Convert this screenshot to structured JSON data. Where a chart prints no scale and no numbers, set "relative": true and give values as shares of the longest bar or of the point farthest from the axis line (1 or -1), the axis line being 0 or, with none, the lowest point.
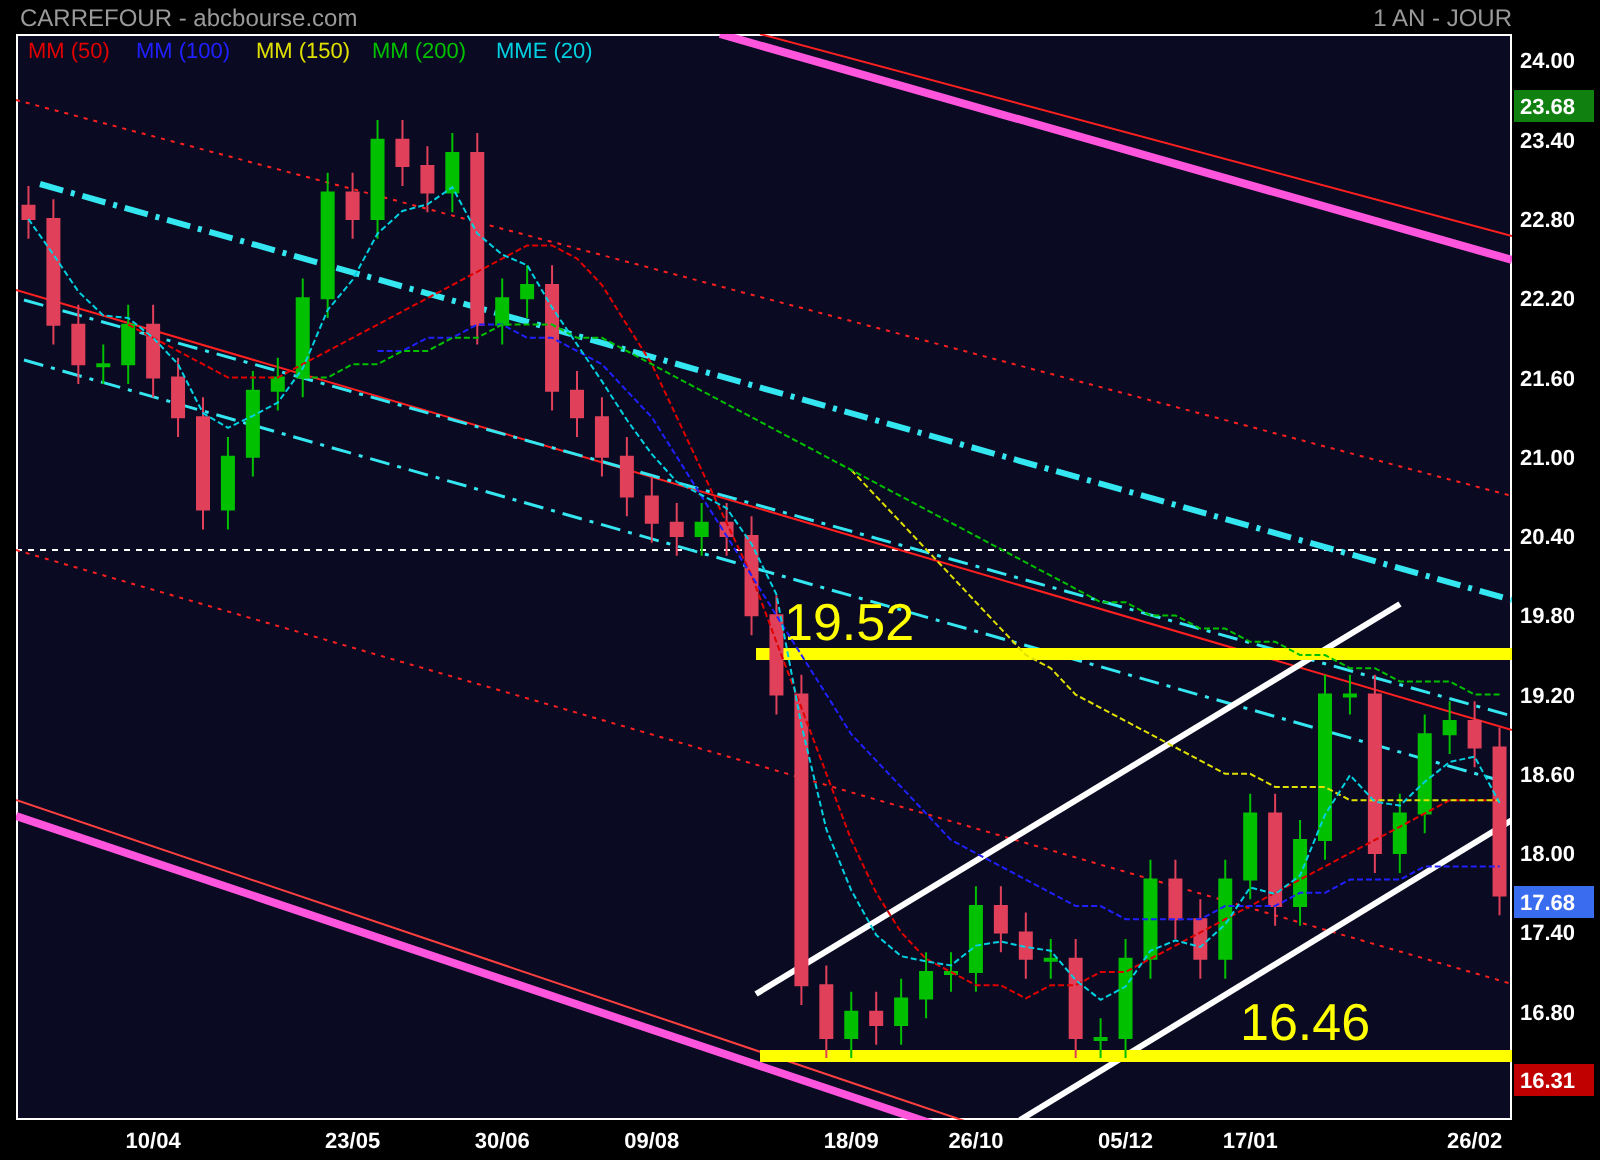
{
  "header": {
    "title": "CARREFOUR - abcbourse.com",
    "period": "1 AN - JOUR"
  },
  "chart": {
    "chart_data": {
      "type": "candlestick",
      "categories": [
        null,
        null,
        null,
        null,
        null,
        "10/04",
        null,
        null,
        null,
        null,
        null,
        null,
        null,
        "23/05",
        null,
        null,
        null,
        null,
        null,
        "30/06",
        null,
        null,
        null,
        null,
        null,
        "09/08",
        null,
        null,
        null,
        null,
        null,
        null,
        null,
        "18/09",
        null,
        null,
        null,
        null,
        "26/10",
        null,
        null,
        null,
        null,
        null,
        "05/12",
        null,
        null,
        null,
        null,
        "17/01",
        null,
        null,
        null,
        null,
        null,
        null,
        null,
        null,
        "26/02",
        null
      ],
      "ohlc": [
        [
          22.9,
          23.05,
          22.65,
          22.8
        ],
        [
          22.8,
          22.95,
          21.85,
          22.0
        ],
        [
          22.0,
          22.15,
          21.55,
          21.7
        ],
        [
          21.7,
          21.85,
          21.55,
          21.7
        ],
        [
          21.7,
          22.15,
          21.55,
          22.0
        ],
        [
          22.0,
          22.15,
          21.45,
          21.6
        ],
        [
          21.6,
          21.75,
          21.15,
          21.3
        ],
        [
          21.3,
          21.45,
          20.45,
          20.6
        ],
        [
          20.6,
          21.15,
          20.45,
          21.0
        ],
        [
          21.0,
          21.65,
          20.85,
          21.5
        ],
        [
          21.5,
          21.75,
          21.35,
          21.6
        ],
        [
          21.6,
          22.35,
          21.45,
          22.2
        ],
        [
          22.2,
          23.15,
          22.05,
          23.0
        ],
        [
          23.0,
          23.15,
          22.65,
          22.8
        ],
        [
          22.8,
          23.55,
          22.65,
          23.4
        ],
        [
          23.4,
          23.55,
          23.05,
          23.2
        ],
        [
          23.2,
          23.35,
          22.85,
          23.0
        ],
        [
          23.0,
          23.45,
          22.85,
          23.3
        ],
        [
          23.3,
          23.45,
          21.85,
          22.0
        ],
        [
          22.0,
          22.35,
          21.85,
          22.2
        ],
        [
          22.2,
          22.45,
          22.05,
          22.3
        ],
        [
          22.3,
          22.45,
          21.35,
          21.5
        ],
        [
          21.5,
          21.65,
          21.15,
          21.3
        ],
        [
          21.3,
          21.45,
          20.85,
          21.0
        ],
        [
          21.0,
          21.15,
          20.55,
          20.7
        ],
        [
          20.7,
          20.85,
          20.35,
          20.5
        ],
        [
          20.5,
          20.65,
          20.25,
          20.4
        ],
        [
          20.4,
          20.65,
          20.25,
          20.5
        ],
        [
          20.5,
          20.65,
          20.25,
          20.4
        ],
        [
          20.4,
          20.55,
          19.65,
          19.8
        ],
        [
          19.8,
          19.95,
          19.05,
          19.2
        ],
        [
          19.2,
          19.35,
          16.85,
          17.0
        ],
        [
          17.0,
          17.15,
          16.45,
          16.6
        ],
        [
          16.6,
          16.95,
          16.45,
          16.8
        ],
        [
          16.8,
          16.95,
          16.55,
          16.7
        ],
        [
          16.7,
          17.05,
          16.55,
          16.9
        ],
        [
          16.9,
          17.25,
          16.75,
          17.1
        ],
        [
          17.1,
          17.25,
          16.95,
          17.1
        ],
        [
          17.1,
          17.75,
          16.95,
          17.6
        ],
        [
          17.6,
          17.75,
          17.25,
          17.4
        ],
        [
          17.4,
          17.55,
          17.05,
          17.2
        ],
        [
          17.2,
          17.35,
          17.05,
          17.2
        ],
        [
          17.2,
          17.35,
          16.45,
          16.6
        ],
        [
          16.6,
          16.75,
          16.45,
          16.6
        ],
        [
          16.6,
          17.35,
          16.45,
          17.2
        ],
        [
          17.2,
          17.95,
          17.05,
          17.8
        ],
        [
          17.8,
          17.95,
          17.35,
          17.5
        ],
        [
          17.5,
          17.65,
          17.05,
          17.2
        ],
        [
          17.2,
          17.95,
          17.05,
          17.8
        ],
        [
          17.8,
          18.45,
          17.65,
          18.3
        ],
        [
          18.3,
          18.45,
          17.45,
          17.6
        ],
        [
          17.6,
          18.25,
          17.45,
          18.1
        ],
        [
          18.1,
          19.35,
          17.95,
          19.2
        ],
        [
          19.2,
          19.35,
          19.05,
          19.2
        ],
        [
          19.2,
          19.35,
          17.85,
          18.0
        ],
        [
          18.0,
          18.45,
          17.85,
          18.3
        ],
        [
          18.3,
          19.05,
          18.15,
          18.9
        ],
        [
          18.9,
          19.15,
          18.75,
          19.0
        ],
        [
          19.0,
          19.15,
          18.65,
          18.8
        ],
        [
          18.8,
          18.95,
          17.53,
          17.68
        ]
      ],
      "ylim": [
        15.98,
        24.2
      ],
      "yticks": [
        {
          "value": 24,
          "label": "24.00"
        },
        {
          "value": 23.4,
          "label": "23.40"
        },
        {
          "value": 22.8,
          "label": "22.80"
        },
        {
          "value": 22.2,
          "label": "22.20"
        },
        {
          "value": 21.6,
          "label": "21.60"
        },
        {
          "value": 21,
          "label": "21.00"
        },
        {
          "value": 20.4,
          "label": "20.40"
        },
        {
          "value": 19.8,
          "label": "19.80"
        },
        {
          "value": 19.2,
          "label": "19.20"
        },
        {
          "value": 18.6,
          "label": "18.60"
        },
        {
          "value": 18,
          "label": "18.00"
        },
        {
          "value": 17.4,
          "label": "17.40"
        },
        {
          "value": 16.8,
          "label": "16.80"
        }
      ]
    },
    "levels": [
      {
        "label": "19.52"
      },
      {
        "label": "16.46"
      }
    ],
    "price_tags": [
      {
        "label": "23.68",
        "color": "#108010"
      },
      {
        "label": "17.68",
        "color": "#3a6cf0"
      },
      {
        "label": "16.31",
        "color": "#c00000"
      }
    ],
    "overlay": {
      "chart_data": {
        "type": "line",
        "relative": true,
        "ylim": [
          15.98,
          24.2
        ],
        "series": [
          {
            "name": "MM (50)",
            "color": "#e00000",
            "line_style": "dashed",
            "values": [
              null,
              null,
              null,
              null,
              22.0,
              21.9,
              21.8,
              21.7,
              21.6,
              21.6,
              21.6,
              21.7,
              21.8,
              21.9,
              22.0,
              22.1,
              22.2,
              22.3,
              22.4,
              22.5,
              22.6,
              22.6,
              22.5,
              22.3,
              22.0,
              21.7,
              21.3,
              20.9,
              20.5,
              20.1,
              19.6,
              19.1,
              18.6,
              18.1,
              17.7,
              17.4,
              17.2,
              17.1,
              17.0,
              17.0,
              16.9,
              17.0,
              17.0,
              17.1,
              17.1,
              17.2,
              17.3,
              17.4,
              17.5,
              17.6,
              17.7,
              17.8,
              17.9,
              18.0,
              18.1,
              18.2,
              18.3,
              18.4,
              18.4,
              18.4
            ]
          },
          {
            "name": "MM (100)",
            "color": "#2020ff",
            "line_style": "dashed",
            "values": [
              null,
              null,
              null,
              null,
              null,
              null,
              null,
              null,
              null,
              null,
              null,
              null,
              null,
              null,
              21.8,
              21.8,
              21.9,
              21.9,
              22.0,
              22.0,
              21.9,
              21.9,
              21.8,
              21.7,
              21.5,
              21.3,
              21.0,
              20.7,
              20.4,
              20.1,
              19.8,
              19.5,
              19.2,
              18.9,
              18.7,
              18.5,
              18.3,
              18.1,
              18.0,
              17.9,
              17.8,
              17.7,
              17.6,
              17.6,
              17.5,
              17.5,
              17.5,
              17.5,
              17.6,
              17.6,
              17.6,
              17.7,
              17.7,
              17.8,
              17.8,
              17.8,
              17.9,
              17.9,
              17.9,
              17.9
            ]
          },
          {
            "name": "MM (150)",
            "color": "#e0e000",
            "line_style": "dashed",
            "values": [
              null,
              null,
              null,
              null,
              null,
              null,
              null,
              null,
              null,
              null,
              null,
              null,
              null,
              null,
              null,
              null,
              null,
              null,
              null,
              null,
              null,
              null,
              null,
              null,
              null,
              null,
              null,
              null,
              null,
              null,
              null,
              null,
              null,
              20.9,
              20.7,
              20.5,
              20.3,
              20.1,
              19.9,
              19.7,
              19.5,
              19.4,
              19.2,
              19.1,
              19.0,
              18.9,
              18.8,
              18.7,
              18.6,
              18.6,
              18.5,
              18.5,
              18.5,
              18.4,
              18.4,
              18.4,
              18.4,
              18.4,
              18.4,
              18.4
            ]
          },
          {
            "name": "MM (200)",
            "color": "#00c000",
            "line_style": "dashed",
            "values": [
              null,
              null,
              null,
              null,
              null,
              null,
              null,
              null,
              null,
              null,
              null,
              21.6,
              21.6,
              21.7,
              21.7,
              21.8,
              21.8,
              21.9,
              21.9,
              22.0,
              22.0,
              22.0,
              21.9,
              21.9,
              21.8,
              21.7,
              21.6,
              21.5,
              21.4,
              21.3,
              21.2,
              21.1,
              21.0,
              20.9,
              20.8,
              20.7,
              20.6,
              20.5,
              20.4,
              20.3,
              20.2,
              20.1,
              20.0,
              19.9,
              19.9,
              19.8,
              19.8,
              19.7,
              19.7,
              19.6,
              19.6,
              19.5,
              19.5,
              19.4,
              19.4,
              19.3,
              19.3,
              19.3,
              19.2,
              19.2
            ]
          },
          {
            "name": "MME (20)",
            "color": "#00d0e0",
            "line_style": "dashed",
            "values": [
              22.8,
              22.53,
              22.25,
              22.07,
              22.05,
              21.9,
              21.7,
              21.33,
              21.22,
              21.31,
              21.41,
              21.67,
              22.11,
              22.34,
              22.69,
              22.86,
              22.91,
              23.04,
              22.69,
              22.53,
              22.45,
              22.13,
              21.85,
              21.57,
              21.28,
              21.02,
              20.81,
              20.71,
              20.61,
              20.34,
              19.96,
              18.97,
              18.18,
              17.72,
              17.38,
              17.22,
              17.18,
              17.15,
              17.3,
              17.33,
              17.29,
              17.26,
              17.04,
              16.89,
              16.99,
              17.26,
              17.34,
              17.29,
              17.46,
              17.74,
              17.69,
              17.83,
              18.29,
              18.59,
              18.39,
              18.36,
              18.54,
              18.69,
              18.73,
              18.38
            ]
          }
        ]
      }
    }
  }
}
